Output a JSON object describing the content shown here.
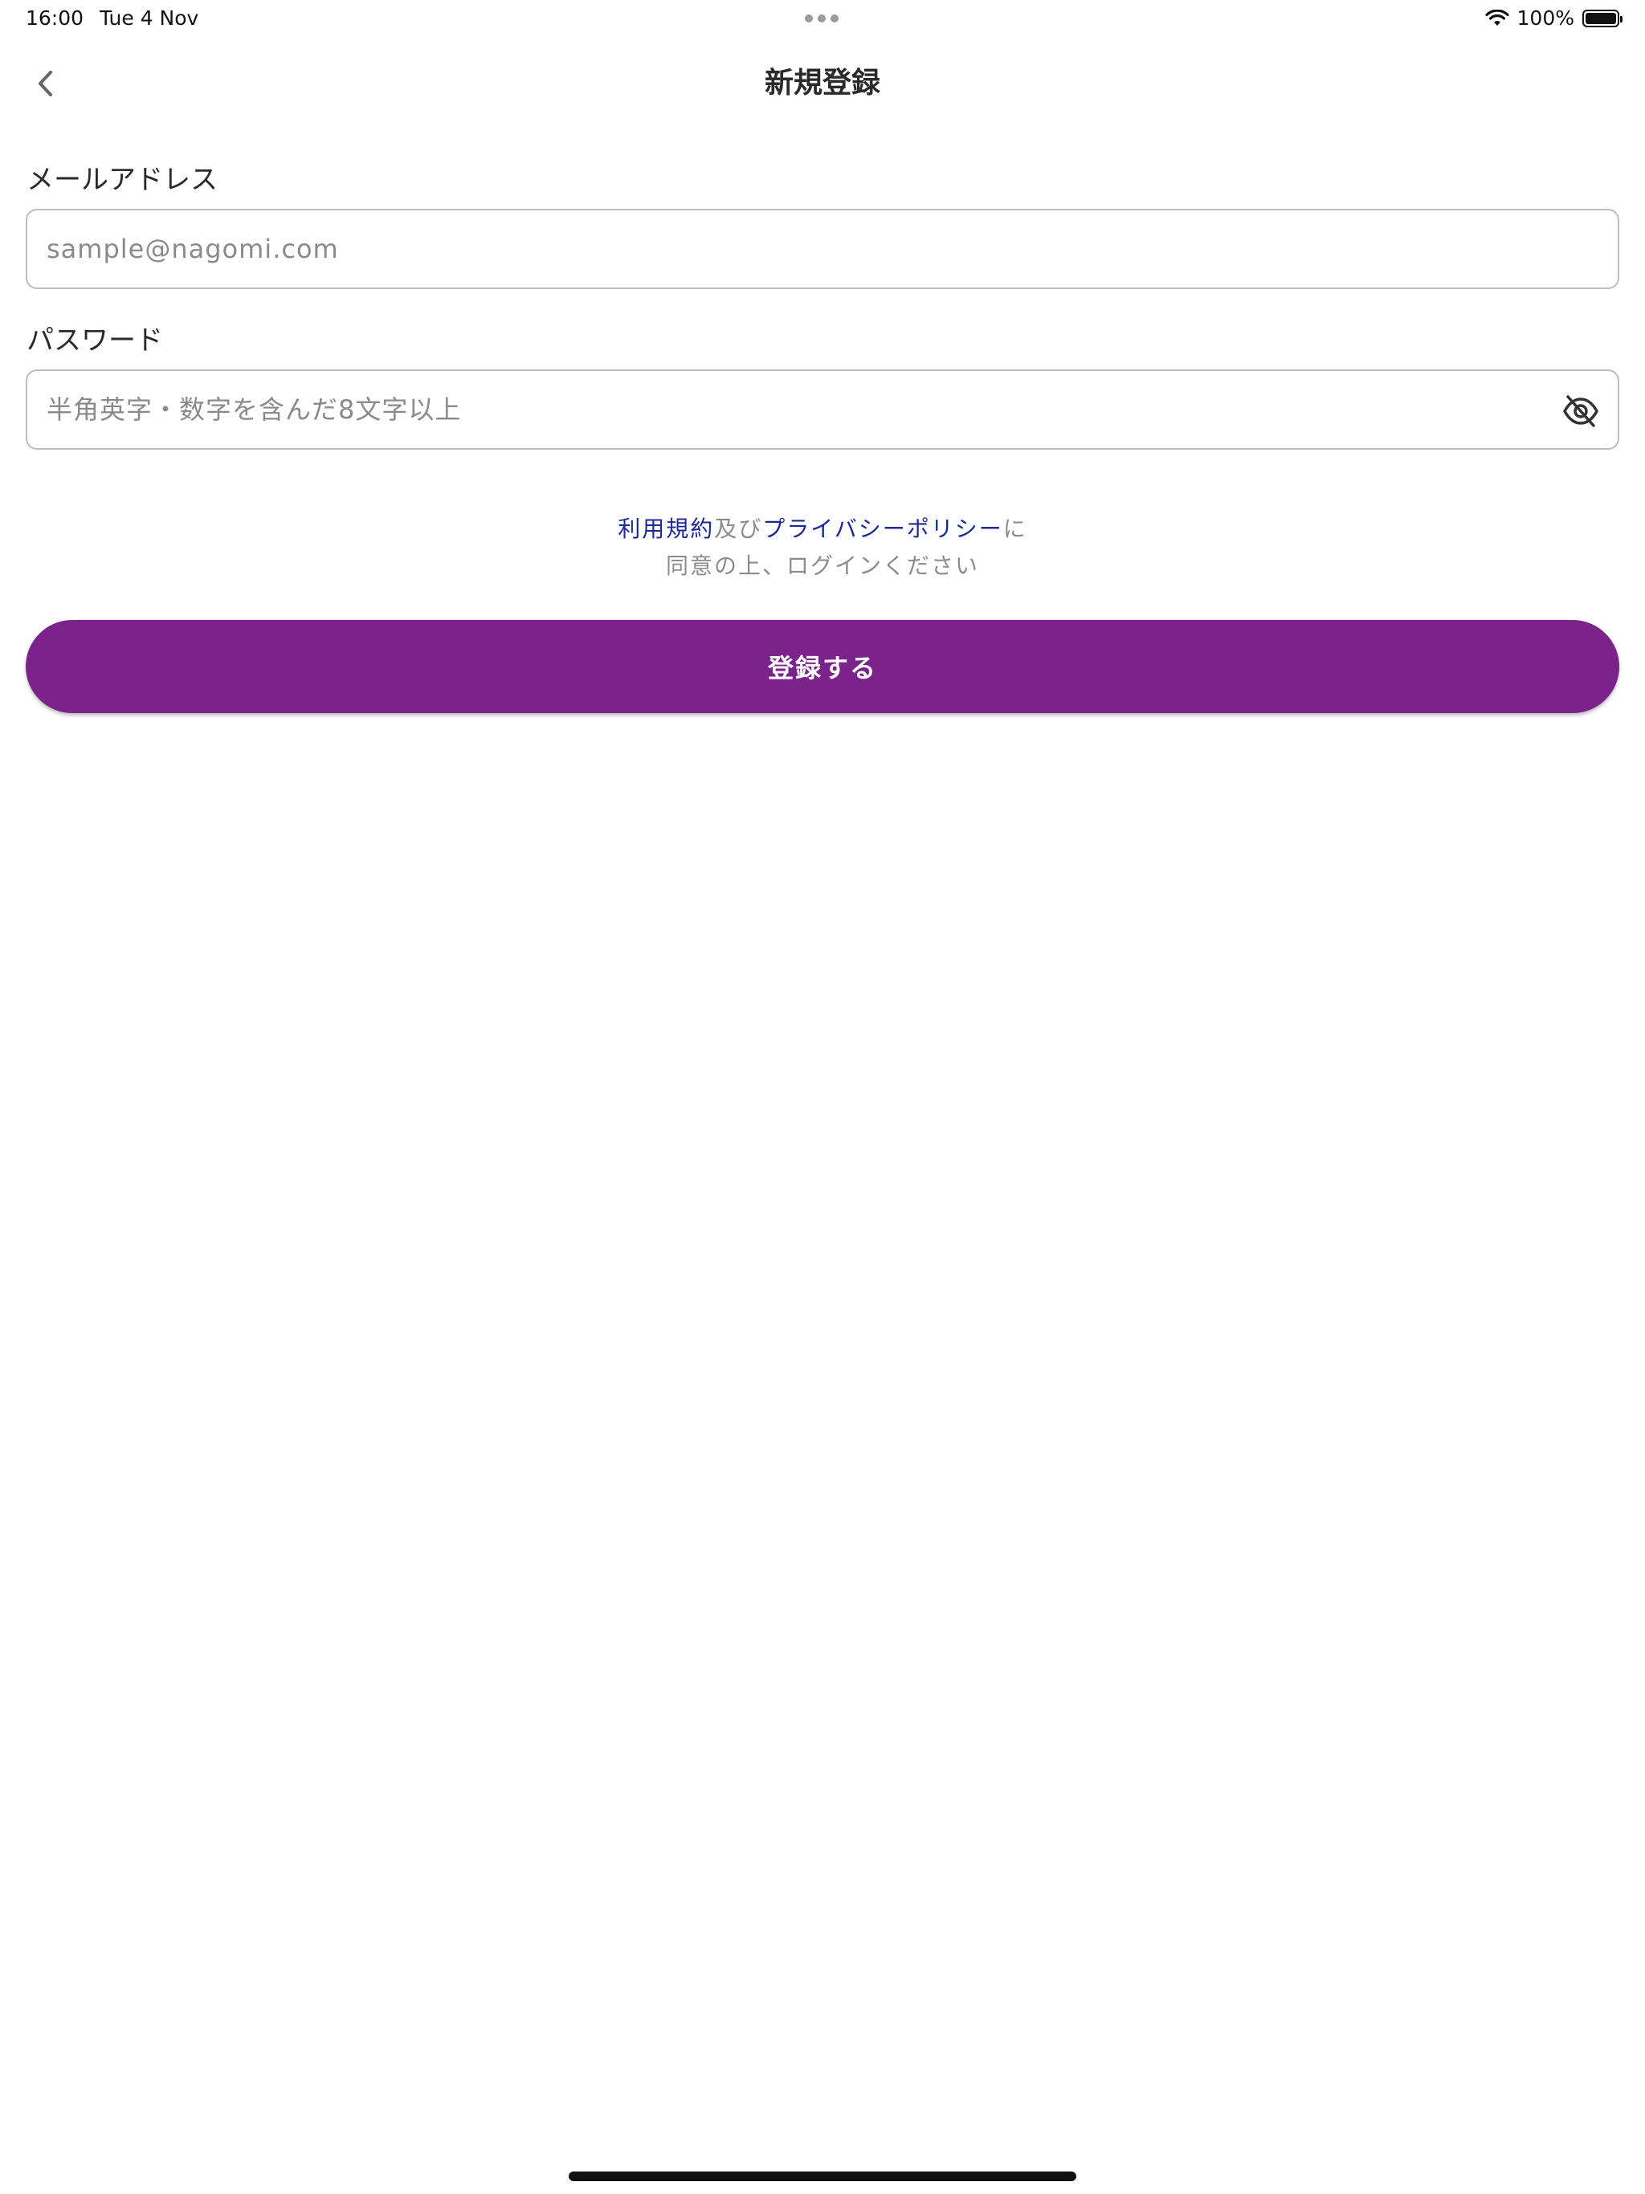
{
  "status_bar": {
    "time": "16:00",
    "date": "Tue 4 Nov",
    "battery_percent": "100%"
  },
  "nav": {
    "title": "新規登録"
  },
  "form": {
    "email": {
      "label": "メールアドレス",
      "placeholder": "sample@nagomi.com",
      "value": ""
    },
    "password": {
      "label": "パスワード",
      "placeholder": "半角英字・数字を含んだ8文字以上",
      "value": ""
    }
  },
  "terms": {
    "terms_link": "利用規約",
    "and_text": "及び",
    "privacy_link": "プライバシーポリシー",
    "suffix": "に",
    "line2": "同意の上、ログインください"
  },
  "actions": {
    "register_label": "登録する"
  },
  "colors": {
    "primary": "#7b228b",
    "link": "#1a2a9a",
    "placeholder": "#8a8a8a",
    "border": "#bdbdbd"
  },
  "icons": {
    "back": "chevron-left-icon",
    "password_toggle": "eye-off-icon",
    "wifi": "wifi-icon",
    "battery": "battery-icon"
  }
}
